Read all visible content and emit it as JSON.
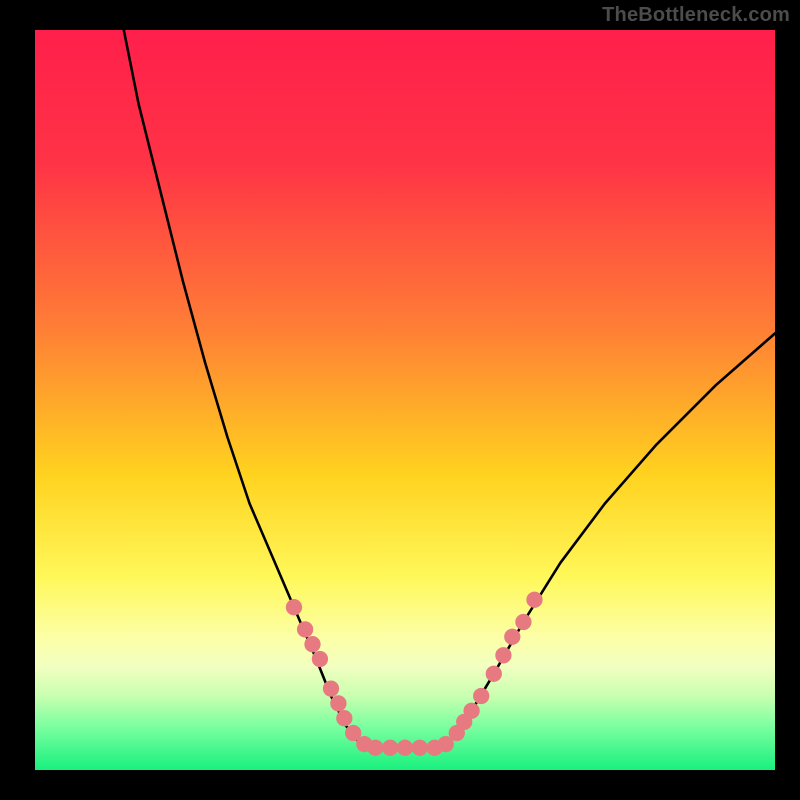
{
  "watermark": "TheBottleneck.com",
  "chart_data": {
    "type": "line",
    "title": "",
    "xlabel": "",
    "ylabel": "",
    "xlim": [
      0,
      100
    ],
    "ylim": [
      0,
      100
    ],
    "background_gradient": {
      "stops": [
        {
          "offset": 0,
          "color": "#ff1f4b"
        },
        {
          "offset": 18,
          "color": "#ff3346"
        },
        {
          "offset": 40,
          "color": "#ff7d36"
        },
        {
          "offset": 60,
          "color": "#ffd21f"
        },
        {
          "offset": 74,
          "color": "#fff85a"
        },
        {
          "offset": 82,
          "color": "#fcffa6"
        },
        {
          "offset": 86,
          "color": "#f2ffc0"
        },
        {
          "offset": 90,
          "color": "#c8ffb0"
        },
        {
          "offset": 94,
          "color": "#7dffa0"
        },
        {
          "offset": 100,
          "color": "#18f07e"
        }
      ]
    },
    "series": [
      {
        "name": "left-curve",
        "values": [
          {
            "x": 12,
            "y": 100
          },
          {
            "x": 14,
            "y": 90
          },
          {
            "x": 17,
            "y": 78
          },
          {
            "x": 20,
            "y": 66
          },
          {
            "x": 23,
            "y": 55
          },
          {
            "x": 26,
            "y": 45
          },
          {
            "x": 29,
            "y": 36
          },
          {
            "x": 32,
            "y": 29
          },
          {
            "x": 35,
            "y": 22
          },
          {
            "x": 38,
            "y": 15
          },
          {
            "x": 40,
            "y": 10
          },
          {
            "x": 42,
            "y": 6
          },
          {
            "x": 44,
            "y": 3.5
          },
          {
            "x": 46,
            "y": 3
          }
        ]
      },
      {
        "name": "flat-trough",
        "values": [
          {
            "x": 46,
            "y": 3
          },
          {
            "x": 54,
            "y": 3
          }
        ]
      },
      {
        "name": "right-curve",
        "values": [
          {
            "x": 54,
            "y": 3
          },
          {
            "x": 56,
            "y": 4
          },
          {
            "x": 59,
            "y": 8
          },
          {
            "x": 62,
            "y": 13
          },
          {
            "x": 66,
            "y": 20
          },
          {
            "x": 71,
            "y": 28
          },
          {
            "x": 77,
            "y": 36
          },
          {
            "x": 84,
            "y": 44
          },
          {
            "x": 92,
            "y": 52
          },
          {
            "x": 100,
            "y": 59
          }
        ]
      }
    ],
    "markers": {
      "color": "#e77a80",
      "radius": 1.1,
      "points": [
        {
          "x": 35,
          "y": 22
        },
        {
          "x": 36.5,
          "y": 19
        },
        {
          "x": 37.5,
          "y": 17
        },
        {
          "x": 38.5,
          "y": 15
        },
        {
          "x": 40,
          "y": 11
        },
        {
          "x": 41,
          "y": 9
        },
        {
          "x": 41.8,
          "y": 7
        },
        {
          "x": 43,
          "y": 5
        },
        {
          "x": 44.5,
          "y": 3.5
        },
        {
          "x": 46,
          "y": 3
        },
        {
          "x": 48,
          "y": 3
        },
        {
          "x": 50,
          "y": 3
        },
        {
          "x": 52,
          "y": 3
        },
        {
          "x": 54,
          "y": 3
        },
        {
          "x": 55.5,
          "y": 3.5
        },
        {
          "x": 57,
          "y": 5
        },
        {
          "x": 58,
          "y": 6.5
        },
        {
          "x": 59,
          "y": 8
        },
        {
          "x": 60.3,
          "y": 10
        },
        {
          "x": 62,
          "y": 13
        },
        {
          "x": 63.3,
          "y": 15.5
        },
        {
          "x": 64.5,
          "y": 18
        },
        {
          "x": 66,
          "y": 20
        },
        {
          "x": 67.5,
          "y": 23
        }
      ]
    }
  }
}
